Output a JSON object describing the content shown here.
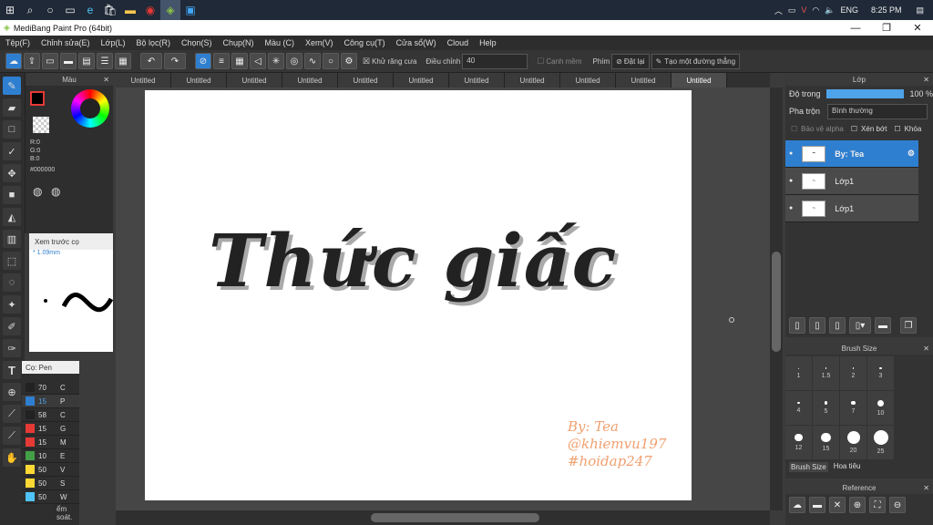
{
  "taskbar": {
    "time": "8:25 PM",
    "lang": "ENG"
  },
  "window": {
    "title": "MediBang Paint Pro (64bit)"
  },
  "menu": [
    "Tệp(F)",
    "Chỉnh sửa(E)",
    "Lớp(L)",
    "Bộ lọc(R)",
    "Chọn(S)",
    "Chụp(N)",
    "Màu (C)",
    "Xem(V)",
    "Công cụ(T)",
    "Cửa sổ(W)",
    "Cloud",
    "Help"
  ],
  "toolbar": {
    "antialias_label": "Khử răng cưa",
    "adjust_label": "Điều chỉnh",
    "adjust_value": "40",
    "soft_edge_label": "Cạnh mềm",
    "key_label": "Phím",
    "reset_label": "Đặt lại",
    "straight_line_label": "Tạo một đường thẳng"
  },
  "color": {
    "title": "Màu",
    "r": "R:0",
    "g": "G:0",
    "b": "B:0",
    "hex": "#000000"
  },
  "preview": {
    "title": "Xem trước cọ",
    "size": "* 1.09mm"
  },
  "pen": {
    "title": "Cọ: Pen",
    "items": [
      {
        "size": "70",
        "name": "C",
        "color": "#222222"
      },
      {
        "size": "15",
        "name": "P",
        "color": "#2f7fd0"
      },
      {
        "size": "58",
        "name": "C",
        "color": "#222222"
      },
      {
        "size": "15",
        "name": "G",
        "color": "#e53935"
      },
      {
        "size": "15",
        "name": "M",
        "color": "#e53935"
      },
      {
        "size": "10",
        "name": "E",
        "color": "#43a047"
      },
      {
        "size": "50",
        "name": "V",
        "color": "#fdd835"
      },
      {
        "size": "50",
        "name": "S",
        "color": "#fdd835"
      },
      {
        "size": "50",
        "name": "W",
        "color": "#4fc3f7"
      }
    ],
    "footer": "ểm soát."
  },
  "tabs": [
    "Untitled",
    "Untitled",
    "Untitled",
    "Untitled",
    "Untitled",
    "Untitled",
    "Untitled",
    "Untitled",
    "Untitled",
    "Untitled",
    "Untitled"
  ],
  "artwork": {
    "title": "Thức giấc",
    "credit1": "By: Tea",
    "credit2": "@khiemvu197",
    "credit3": "#hoidap247"
  },
  "layer": {
    "title": "Lớp",
    "opacity_label": "Độ trong",
    "opacity_value": "100 %",
    "blend_label": "Pha trộn",
    "blend_value": "Bình thường",
    "protect_alpha": "Bảo vệ alpha",
    "clip": "Xén bớt",
    "lock": "Khóa",
    "items": [
      {
        "name": "By: Tea",
        "selected": true
      },
      {
        "name": "Lớp1",
        "selected": false
      },
      {
        "name": "Lớp1",
        "selected": false
      }
    ]
  },
  "brush": {
    "title": "Brush Size",
    "tab1": "Brush Size",
    "tab2": "Hoa tiêu",
    "sizes": [
      "1",
      "1.5",
      "2",
      "3",
      "4",
      "5",
      "7",
      "10",
      "12",
      "15",
      "20",
      "25"
    ]
  },
  "reference": {
    "title": "Reference"
  }
}
